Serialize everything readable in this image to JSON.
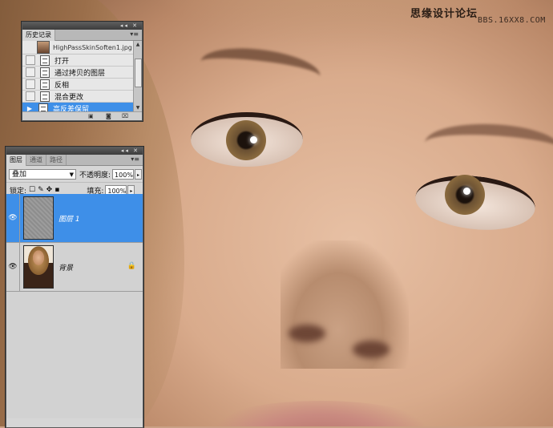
{
  "watermark": {
    "line1": "思缘设计论坛",
    "line2": "BBS.16XX8.COM"
  },
  "history": {
    "panel_controls": "◂◂ ✕",
    "tab": "历史记录",
    "menu": "▾≡",
    "snapshot_name": "HighPassSkinSoften1.jpg",
    "states": [
      {
        "label": "打开"
      },
      {
        "label": "通过拷贝的图层"
      },
      {
        "label": "反相"
      },
      {
        "label": "混合更改"
      },
      {
        "label": "高反差保留"
      }
    ],
    "selected_index": 4
  },
  "layers": {
    "panel_controls": "◂◂ ✕",
    "tabs": [
      "图层",
      "通道",
      "路径"
    ],
    "menu": "▾≡",
    "blend_mode": "叠加",
    "opacity_label": "不透明度:",
    "opacity_value": "100%",
    "lock_label": "锁定:",
    "fill_label": "填充:",
    "fill_value": "100%",
    "items": [
      {
        "name": "图层 1",
        "selected": true
      },
      {
        "name": "背景",
        "selected": false,
        "locked": true
      }
    ]
  },
  "icons": {
    "eye": "👁",
    "lock": "🔒"
  }
}
